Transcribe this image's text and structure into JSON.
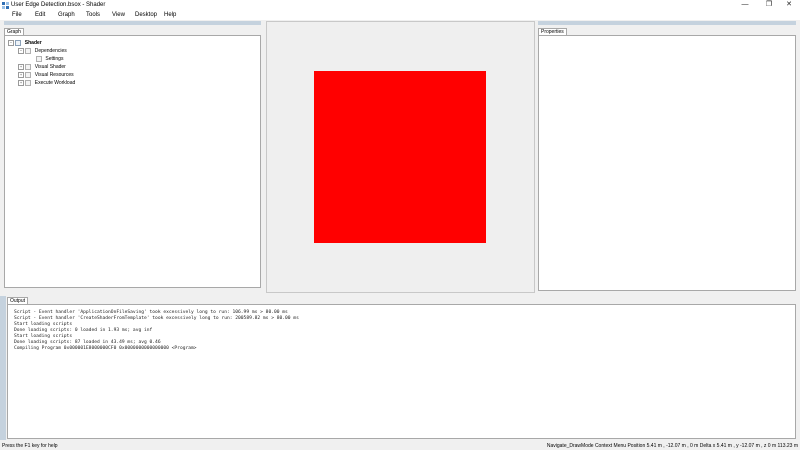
{
  "window": {
    "title": "User Edge Detection.bsox - Shader",
    "minimize": "—",
    "restore": "❐",
    "close": "✕"
  },
  "menu": [
    "File",
    "Edit",
    "Graph",
    "Tools",
    "View",
    "Desktop",
    "Help"
  ],
  "graph_panel": {
    "tab": "Graph",
    "tree": {
      "root": "Shader",
      "dependencies": "Dependencies",
      "settings": "Settings",
      "visual_shader": "Visual Shader",
      "visual_resources": "Visual Resources",
      "execute_workload": "Execute Workload"
    }
  },
  "properties_panel": {
    "tab": "Properties"
  },
  "viewport": {
    "quad_color": "#ff0000"
  },
  "output_panel": {
    "tab": "Output",
    "lines": [
      "Script - Event handler 'ApplicationOnFileSaving' took excessively long to run: 106.99 ms > 80.00 ms",
      "Script - Event handler 'CreateShaderFromTemplate' took excessively long to run: 200589.82 ms > 80.00 ms",
      "Start loading scripts",
      "Done loading scripts: 0 loaded in 1.93 ms; avg inf",
      "Start loading scripts",
      "Done loading scripts: 87 loaded in 43.49 ms; avg 0.46",
      "Compiling Program 0x000001E8000000CF0 0x0000000000000000 <Program>"
    ]
  },
  "status": {
    "left": "Press the F1 key for help",
    "right": "Navigate_DrawMode Context Menu   Position 5.41 m , -12.07 m , 0 m   Delta x 5.41 m , y -12.07 m , z 0 m   113.23 m"
  },
  "colors": {
    "panel_header": "#c5d2de",
    "border": "#a8a8a8",
    "accent_icon": "#2f6fb5"
  }
}
